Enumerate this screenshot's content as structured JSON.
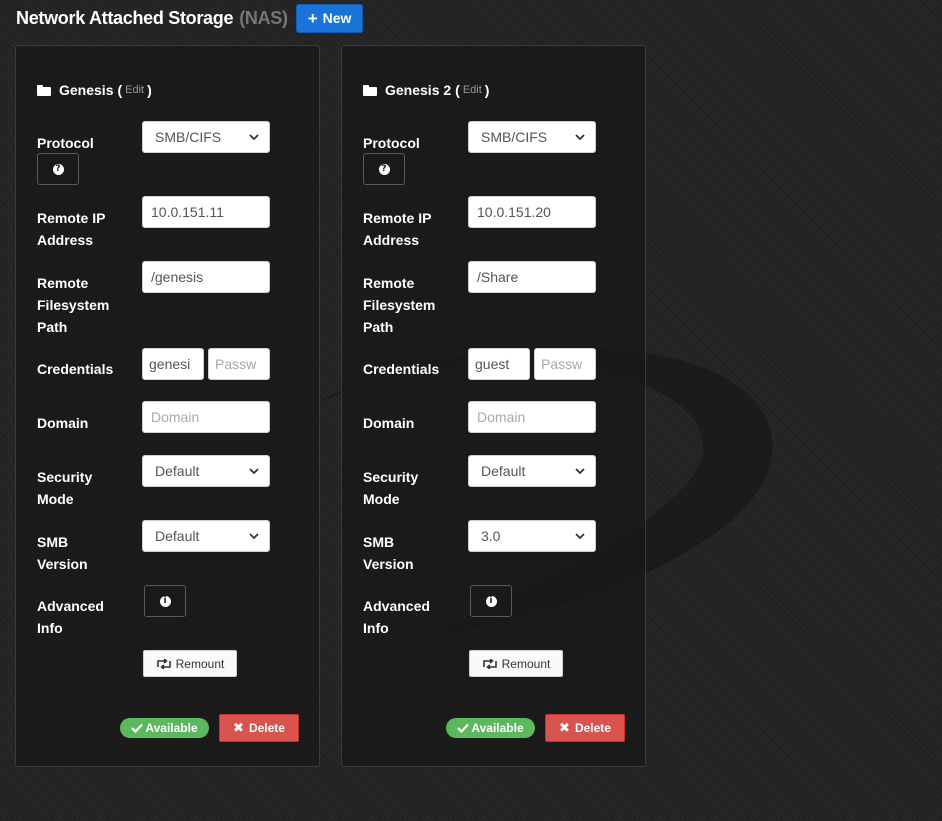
{
  "header": {
    "title": "Network Attached Storage",
    "subtitle": "(NAS)",
    "new_button": "New"
  },
  "labels": {
    "protocol": [
      "Protocol"
    ],
    "remote_ip": [
      "Remote IP",
      "Address"
    ],
    "remote_path": [
      "Remote",
      "Filesystem",
      "Path"
    ],
    "credentials": [
      "Credentials"
    ],
    "domain": [
      "Domain"
    ],
    "security_mode": [
      "Security",
      "Mode"
    ],
    "smb_version": [
      "SMB",
      "Version"
    ],
    "advanced_info": [
      "Advanced",
      "Info"
    ]
  },
  "shares": [
    {
      "name": "Genesis",
      "edit_label": "Edit",
      "protocol": "SMB/CIFS",
      "remote_ip": "10.0.151.11",
      "remote_path": "/genesis",
      "username": "genesi",
      "password_placeholder": "Passw",
      "domain_placeholder": "Domain",
      "security_mode": "Default",
      "smb_version": "Default",
      "remount_label": "Remount",
      "status": "Available",
      "delete_label": "Delete"
    },
    {
      "name": "Genesis 2",
      "edit_label": "Edit",
      "protocol": "SMB/CIFS",
      "remote_ip": "10.0.151.20",
      "remote_path": "/Share",
      "username": "guest",
      "password_placeholder": "Passw",
      "domain_placeholder": "Domain",
      "security_mode": "Default",
      "smb_version": "3.0",
      "remount_label": "Remount",
      "status": "Available",
      "delete_label": "Delete"
    }
  ],
  "icons": {
    "new": "plus-icon",
    "folder": "folder-icon",
    "help": "question-circle-icon",
    "info": "info-circle-icon",
    "remount": "retweet-icon",
    "available": "check-icon",
    "delete": "x-icon"
  },
  "colors": {
    "new_button": "#1a73d9",
    "available": "#5cb85c",
    "delete": "#d9534f"
  }
}
